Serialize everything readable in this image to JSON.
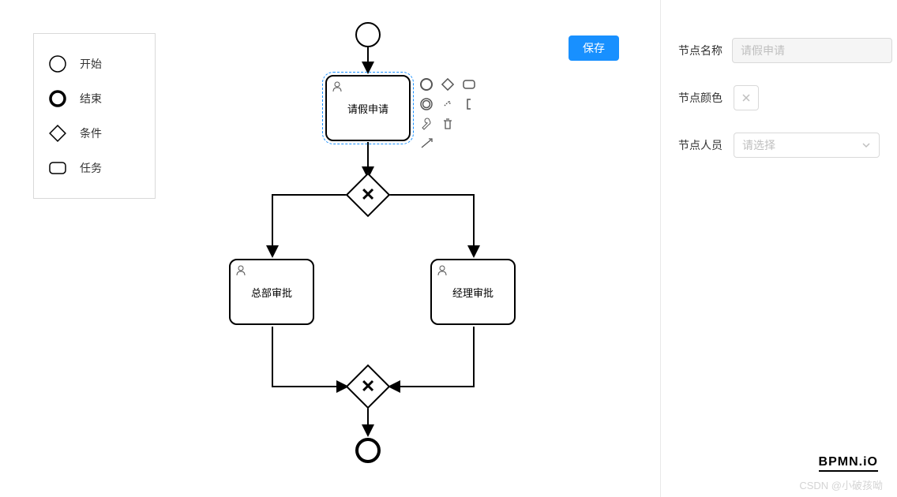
{
  "palette": {
    "start": "开始",
    "end": "结束",
    "condition": "条件",
    "task": "任务"
  },
  "nodes": {
    "task1": "请假申请",
    "task2": "总部审批",
    "task3": "经理审批"
  },
  "contextPad": {
    "items": [
      "start-event",
      "gateway",
      "task",
      "intermediate-event",
      "text-annotation",
      "connect",
      "wrench",
      "delete",
      "replace"
    ]
  },
  "buttons": {
    "save": "保存"
  },
  "form": {
    "name_label": "节点名称",
    "name_value": "请假申请",
    "color_label": "节点颜色",
    "person_label": "节点人员",
    "person_placeholder": "请选择"
  },
  "logo": "BPMN.iO",
  "watermark": "CSDN @小破孩呦"
}
